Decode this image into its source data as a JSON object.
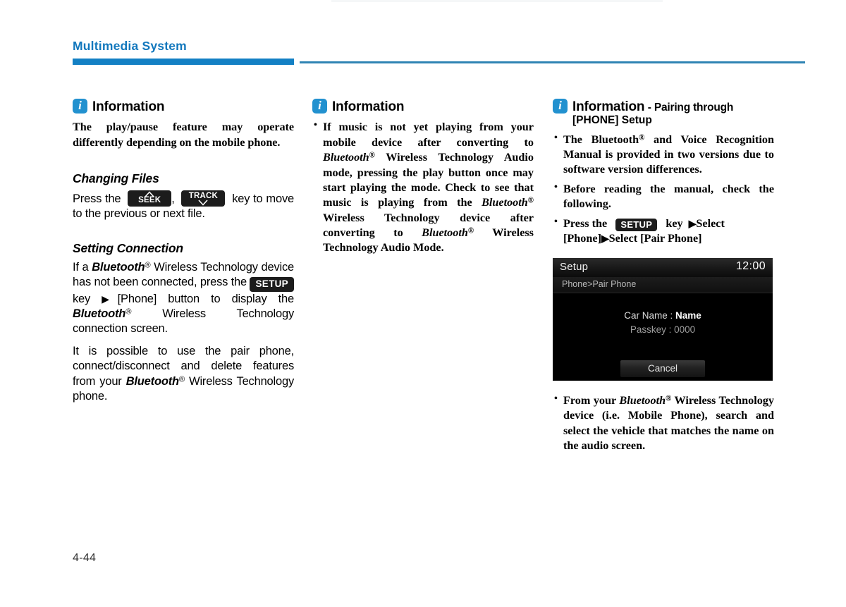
{
  "header": {
    "title": "Multimedia System",
    "accent_color": "#1380c4",
    "rule_thin_color": "#2f84b4"
  },
  "footer": {
    "page_number": "4-44"
  },
  "info_icon": {
    "name": "information-icon",
    "glyph": "i",
    "background_color": "#2291cf",
    "text_color": "#ffffff"
  },
  "column1": {
    "info": {
      "title": "Information",
      "body": "The play/pause feature may operate differently depending on the mobile phone."
    },
    "changing_files": {
      "heading": "Changing Files",
      "text_before": "Press the",
      "seek_key_label": "SEEK",
      "seek_key_chevron": "up",
      "separator": ",",
      "track_key_label": "TRACK",
      "track_key_chevron": "down",
      "text_after": "key to move to the previous or next file."
    },
    "setting_connection": {
      "heading": "Setting Connection",
      "para1_part1": "If a",
      "para1_bluetooth": "Bluetooth",
      "para1_reg": "®",
      "para1_part2": "Wireless Technology device has not been connected, press the",
      "setup_key_label": "SETUP",
      "para1_part3": "key",
      "para1_arrow": "▶",
      "para1_part4": "[Phone] button to display the",
      "para1_bluetooth2": "Bluetooth",
      "para1_part5": "Wireless Technology connection screen.",
      "para2_part1": "It is possible to use the pair phone, connect/disconnect and delete features from your",
      "para2_bluetooth": "Bluetooth",
      "para2_part2": "Wireless Technology phone."
    }
  },
  "column2": {
    "info": {
      "title": "Information",
      "bullets": [
        {
          "part1": "If music is not yet playing from your mobile device after converting to",
          "bluetooth1": "Bluetooth",
          "part2": "Wireless Technology Audio mode, pressing the play button once may start playing the mode. Check to see that music is playing from the",
          "bluetooth2": "Bluetooth",
          "part3": "Wireless Technology device after converting to",
          "bluetooth3": "Bluetooth",
          "part4": "Wireless Technology Audio Mode."
        }
      ]
    }
  },
  "column3": {
    "info": {
      "title": "Information",
      "subtitle_line1": "- Pairing through",
      "subtitle_line2": "[PHONE] Setup",
      "bullet1_part1": "The Bluetooth",
      "bullet1_reg": "®",
      "bullet1_part2": "and Voice Recognition Manual is provided in two versions due to software version differences.",
      "bullet2": "Before reading the manual, check the following.",
      "bullet3_part1": "Press the",
      "bullet3_setup_key": "SETUP",
      "bullet3_part2": "key",
      "bullet3_arrow1": "▶",
      "bullet3_part3": "Select [Phone]",
      "bullet3_arrow2": "▶",
      "bullet3_part4": "Select [Pair Phone]",
      "bullet4_part1": "From your",
      "bullet4_bluetooth": "Bluetooth",
      "bullet4_part2": "Wireless Technology device (i.e. Mobile Phone), search and select the vehicle that matches the name on the audio screen."
    },
    "device_screen": {
      "title": "Setup",
      "clock": "12:00",
      "breadcrumb": "Phone>Pair Phone",
      "car_name_label": "Car Name :",
      "car_name_value": "Name",
      "passkey_label": "Passkey :",
      "passkey_value": "0000",
      "cancel_button": "Cancel"
    }
  }
}
